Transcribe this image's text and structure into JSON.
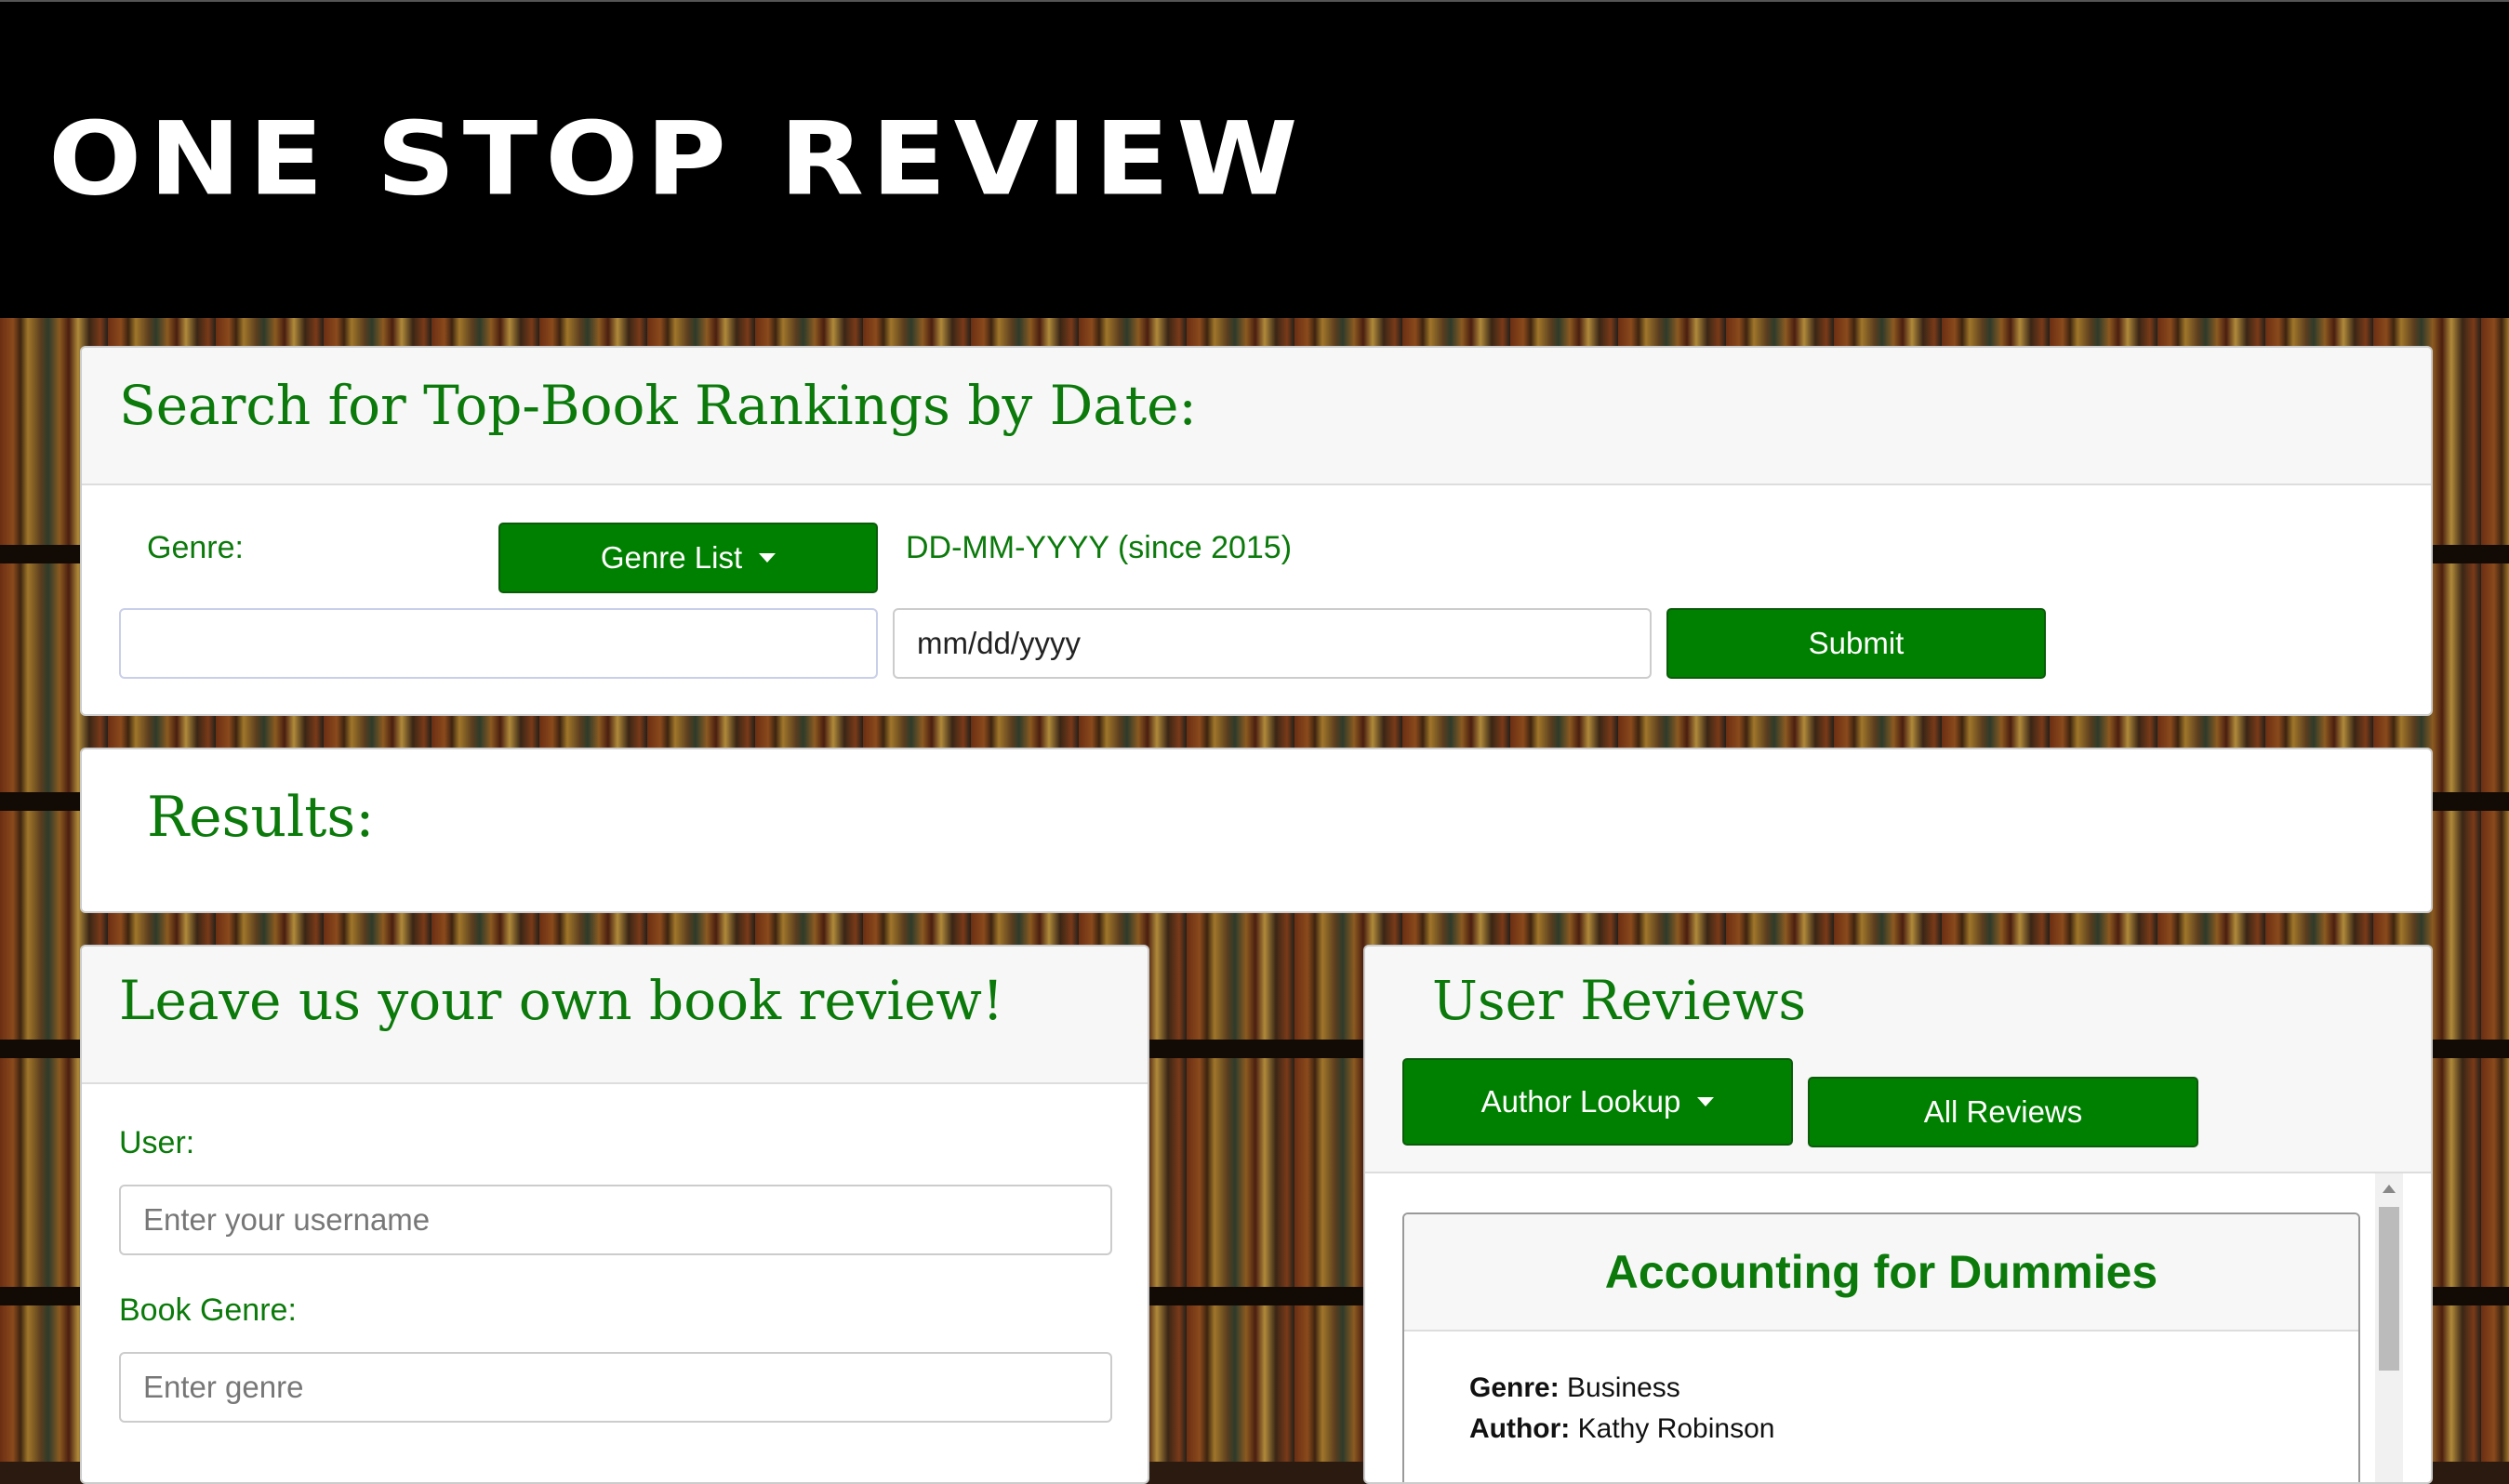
{
  "header": {
    "title": "ONE STOP REVIEW"
  },
  "search": {
    "title": "Search for Top-Book Rankings by Date:",
    "genre_label": "Genre:",
    "genre_button": "Genre List",
    "date_hint": "DD-MM-YYYY (since 2015)",
    "genre_value": "",
    "date_placeholder": "mm/dd/yyyy",
    "submit": "Submit"
  },
  "results": {
    "title": "Results:"
  },
  "review_form": {
    "title": "Leave us your own book review!",
    "user_label": "User:",
    "user_placeholder": "Enter your username",
    "genre_label": "Book Genre:",
    "genre_placeholder": "Enter genre"
  },
  "user_reviews": {
    "title": "User Reviews",
    "author_button": "Author Lookup",
    "all_button": "All Reviews",
    "items": [
      {
        "title": "Accounting for Dummies",
        "genre_label": "Genre:",
        "genre": "Business",
        "author_label": "Author:",
        "author": "Kathy Robinson"
      }
    ]
  },
  "colors": {
    "accent": "#008000",
    "header_bg": "#000000",
    "title_text": "#0b7a0b"
  },
  "icons": [
    "caret-down-icon",
    "scroll-up-arrow-icon"
  ]
}
